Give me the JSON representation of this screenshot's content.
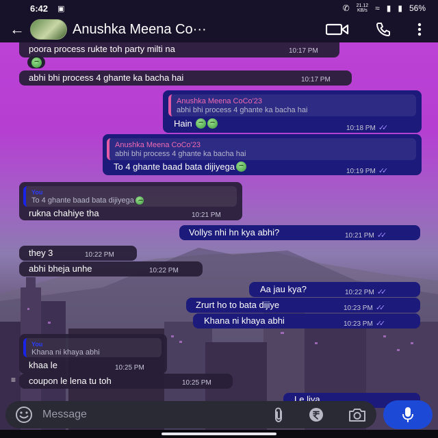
{
  "status_bar": {
    "time": "6:42",
    "speed_value": "21.12",
    "speed_unit": "KB/s",
    "battery": "56%"
  },
  "header": {
    "contact_name": "Anushka Meena Co···"
  },
  "messages": [
    {
      "text": "poora process rukte toh party milti na",
      "time": "10:17 PM"
    },
    {
      "text": "abhi bhi process 4 ghante ka bacha hai",
      "time": "10:17 PM"
    },
    {
      "quote_name": "Anushka Meena CoCo'23",
      "quote_text": "abhi bhi process 4 ghante ka bacha hai",
      "text": "Hain",
      "time": "10:18 PM"
    },
    {
      "quote_name": "Anushka Meena CoCo'23",
      "quote_text": "abhi bhi process 4 ghante ka bacha hai",
      "text": "To 4 ghante baad bata dijiyega",
      "time": "10:19 PM"
    },
    {
      "quote_name": "You",
      "quote_text": "To 4 ghante baad bata dijiyega",
      "text": "rukna chahiye tha",
      "time": "10:21 PM"
    },
    {
      "text": "Vollys nhi hn kya abhi?",
      "time": "10:21 PM"
    },
    {
      "text": "they 3",
      "time": "10:22 PM"
    },
    {
      "text": "abhi bheja unhe",
      "time": "10:22 PM"
    },
    {
      "text": "Aa jau kya?",
      "time": "10:22 PM"
    },
    {
      "text": "Zrurt ho to bata dijiye",
      "time": "10:23 PM"
    },
    {
      "text": "Khana ni khaya abhi",
      "time": "10:23 PM"
    },
    {
      "quote_name": "You",
      "quote_text": "Khana ni khaya abhi",
      "text": "khaa le",
      "time": "10:25 PM"
    },
    {
      "text": "coupon le lena tu toh",
      "time": "10:25 PM"
    },
    {
      "text": "Le liya"
    }
  ],
  "input": {
    "placeholder": "Message"
  },
  "icons": {
    "back": "arrow-left-icon",
    "video": "video-call-icon",
    "call": "phone-icon",
    "menu": "more-vert-icon",
    "emoji": "smiley-icon",
    "attach": "paperclip-icon",
    "payment": "rupee-icon",
    "camera": "camera-icon",
    "mic": "microphone-icon"
  },
  "colors": {
    "outgoing_bubble": "#1c1a7a",
    "incoming_bubble": "#281e37",
    "accent_mic": "#1c4ad6",
    "quote_name": "#f06bb2",
    "read_ticks": "#9d8cff"
  }
}
